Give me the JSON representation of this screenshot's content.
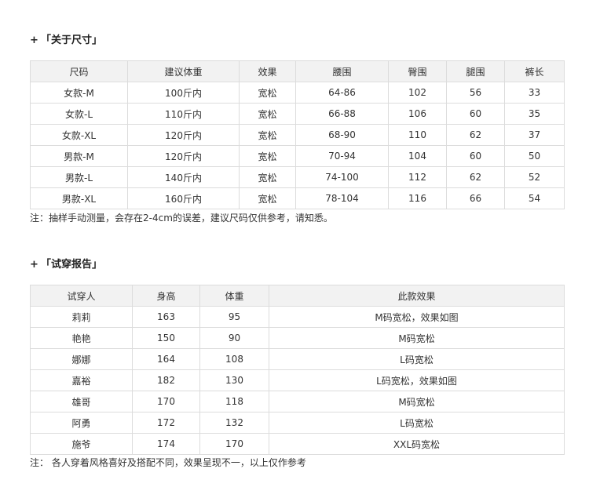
{
  "size_section": {
    "plus": "+",
    "title": "「关于尺寸」",
    "headers": [
      "尺码",
      "建议体重",
      "效果",
      "腰围",
      "臀围",
      "腿围",
      "裤长"
    ],
    "rows": [
      [
        "女款-M",
        "100斤内",
        "宽松",
        "64-86",
        "102",
        "56",
        "33"
      ],
      [
        "女款-L",
        "110斤内",
        "宽松",
        "66-88",
        "106",
        "60",
        "35"
      ],
      [
        "女款-XL",
        "120斤内",
        "宽松",
        "68-90",
        "110",
        "62",
        "37"
      ],
      [
        "男款-M",
        "120斤内",
        "宽松",
        "70-94",
        "104",
        "60",
        "50"
      ],
      [
        "男款-L",
        "140斤内",
        "宽松",
        "74-100",
        "112",
        "62",
        "52"
      ],
      [
        "男款-XL",
        "160斤内",
        "宽松",
        "78-104",
        "116",
        "66",
        "54"
      ]
    ],
    "note": "注：抽样手动测量，会存在2-4cm的误差，建议尺码仅供参考，请知悉。"
  },
  "trial_section": {
    "plus": "+",
    "title": "「试穿报告」",
    "headers": [
      "试穿人",
      "身高",
      "体重",
      "此款效果"
    ],
    "rows": [
      [
        "莉莉",
        "163",
        "95",
        "M码宽松，效果如图"
      ],
      [
        "艳艳",
        "150",
        "90",
        "M码宽松"
      ],
      [
        "娜娜",
        "164",
        "108",
        "L码宽松"
      ],
      [
        "嘉裕",
        "182",
        "130",
        "L码宽松，效果如图"
      ],
      [
        "雄哥",
        "170",
        "118",
        "M码宽松"
      ],
      [
        "阿勇",
        "172",
        "132",
        "L码宽松"
      ],
      [
        "施爷",
        "174",
        "170",
        "XXL码宽松"
      ]
    ],
    "note": "注：  各人穿着风格喜好及搭配不同，效果呈现不一，以上仅作参考"
  }
}
